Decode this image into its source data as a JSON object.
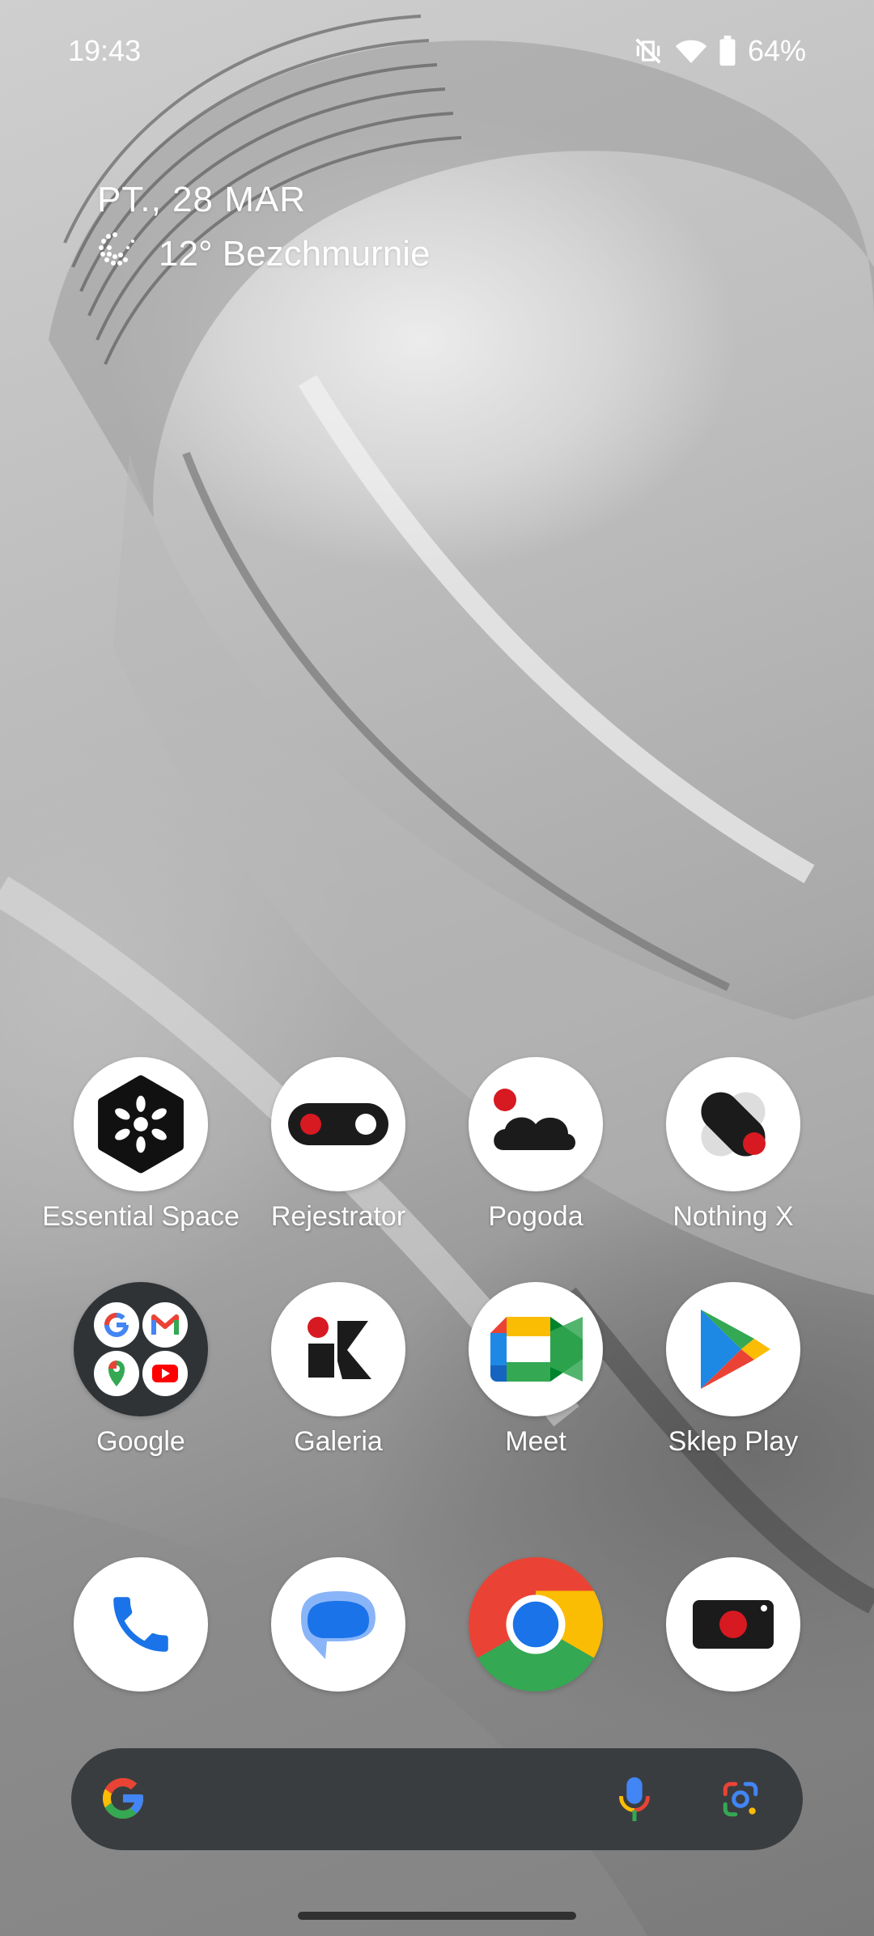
{
  "status_bar": {
    "time": "19:43",
    "battery": "64%"
  },
  "widget": {
    "date": "PT., 28 MAR",
    "weather": "12° Bezchmurnie"
  },
  "apps_row1": [
    {
      "label": "Essential Space",
      "icon": "essential-space-icon"
    },
    {
      "label": "Rejestrator",
      "icon": "recorder-icon"
    },
    {
      "label": "Pogoda",
      "icon": "weather-icon"
    },
    {
      "label": "Nothing X",
      "icon": "nothing-x-icon"
    }
  ],
  "apps_row2": [
    {
      "label": "Google",
      "icon": "google-folder-icon"
    },
    {
      "label": "Galeria",
      "icon": "gallery-icon"
    },
    {
      "label": "Meet",
      "icon": "meet-icon"
    },
    {
      "label": "Sklep Play",
      "icon": "play-store-icon"
    }
  ],
  "dock": [
    {
      "icon": "phone-icon"
    },
    {
      "icon": "messages-icon"
    },
    {
      "icon": "chrome-icon"
    },
    {
      "icon": "camera-icon"
    }
  ],
  "colors": {
    "accent_red": "#d71921",
    "google_blue": "#4285f4",
    "google_red": "#ea4335",
    "google_yellow": "#fbbc04",
    "google_green": "#34a853"
  }
}
